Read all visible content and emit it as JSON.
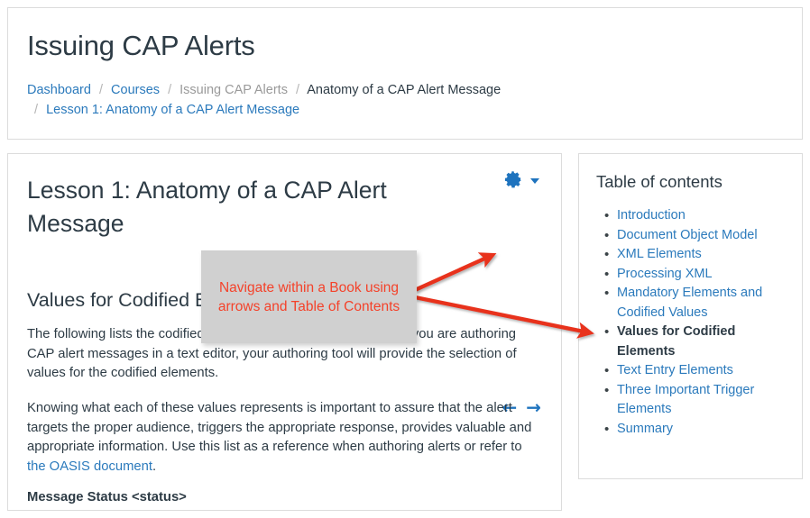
{
  "header": {
    "title": "Issuing CAP Alerts",
    "breadcrumb": [
      {
        "label": "Dashboard",
        "type": "link"
      },
      {
        "label": "Courses",
        "type": "link"
      },
      {
        "label": "Issuing CAP Alerts",
        "type": "muted"
      },
      {
        "label": "Anatomy of a CAP Alert Message",
        "type": "current"
      },
      {
        "label": "Lesson 1: Anatomy of a CAP Alert Message",
        "type": "link"
      }
    ],
    "separator": "/"
  },
  "content": {
    "lesson_title": "Lesson 1: Anatomy of a CAP Alert Message",
    "gear_icon": "gear-icon",
    "caret_icon": "chevron-down-icon",
    "prev_arrow": "←",
    "next_arrow": "→",
    "section_heading": "Values for Codified Elements",
    "paragraph_1": "The following lists the codified elements and their values.  Unless you are authoring CAP alert messages in a text editor, your authoring tool will provide the selection of values for the codified elements.",
    "paragraph_2_part1": "Knowing what each of these values represents is important to assure that the alert targets the proper audience, triggers the appropriate response, provides valuable and appropriate information. Use this list as a reference when authoring alerts or refer to ",
    "paragraph_2_link": "the OASIS document",
    "paragraph_2_part2": ".",
    "bold_line": "Message Status <status>"
  },
  "toc": {
    "title": "Table of contents",
    "items": [
      {
        "label": "Introduction",
        "current": false
      },
      {
        "label": "Document Object Model",
        "current": false
      },
      {
        "label": "XML Elements",
        "current": false
      },
      {
        "label": "Processing XML",
        "current": false
      },
      {
        "label": "Mandatory Elements and Codified Values",
        "current": false
      },
      {
        "label": "Values for Codified Elements",
        "current": true
      },
      {
        "label": "Text Entry Elements",
        "current": false
      },
      {
        "label": "Three Important Trigger Elements",
        "current": false
      },
      {
        "label": "Summary",
        "current": false
      }
    ]
  },
  "annotation": {
    "callout_text": "Navigate within a Book using arrows and Table of Contents",
    "callout_color": "#f4422a",
    "callout_background": "#d0d0d0",
    "arrow_color": "#e8321a"
  },
  "colors": {
    "link": "#2b7abc",
    "text": "#2d3b45",
    "muted": "#9a9a9a",
    "border": "#dcdcdc",
    "icon_blue": "#1e73be"
  }
}
